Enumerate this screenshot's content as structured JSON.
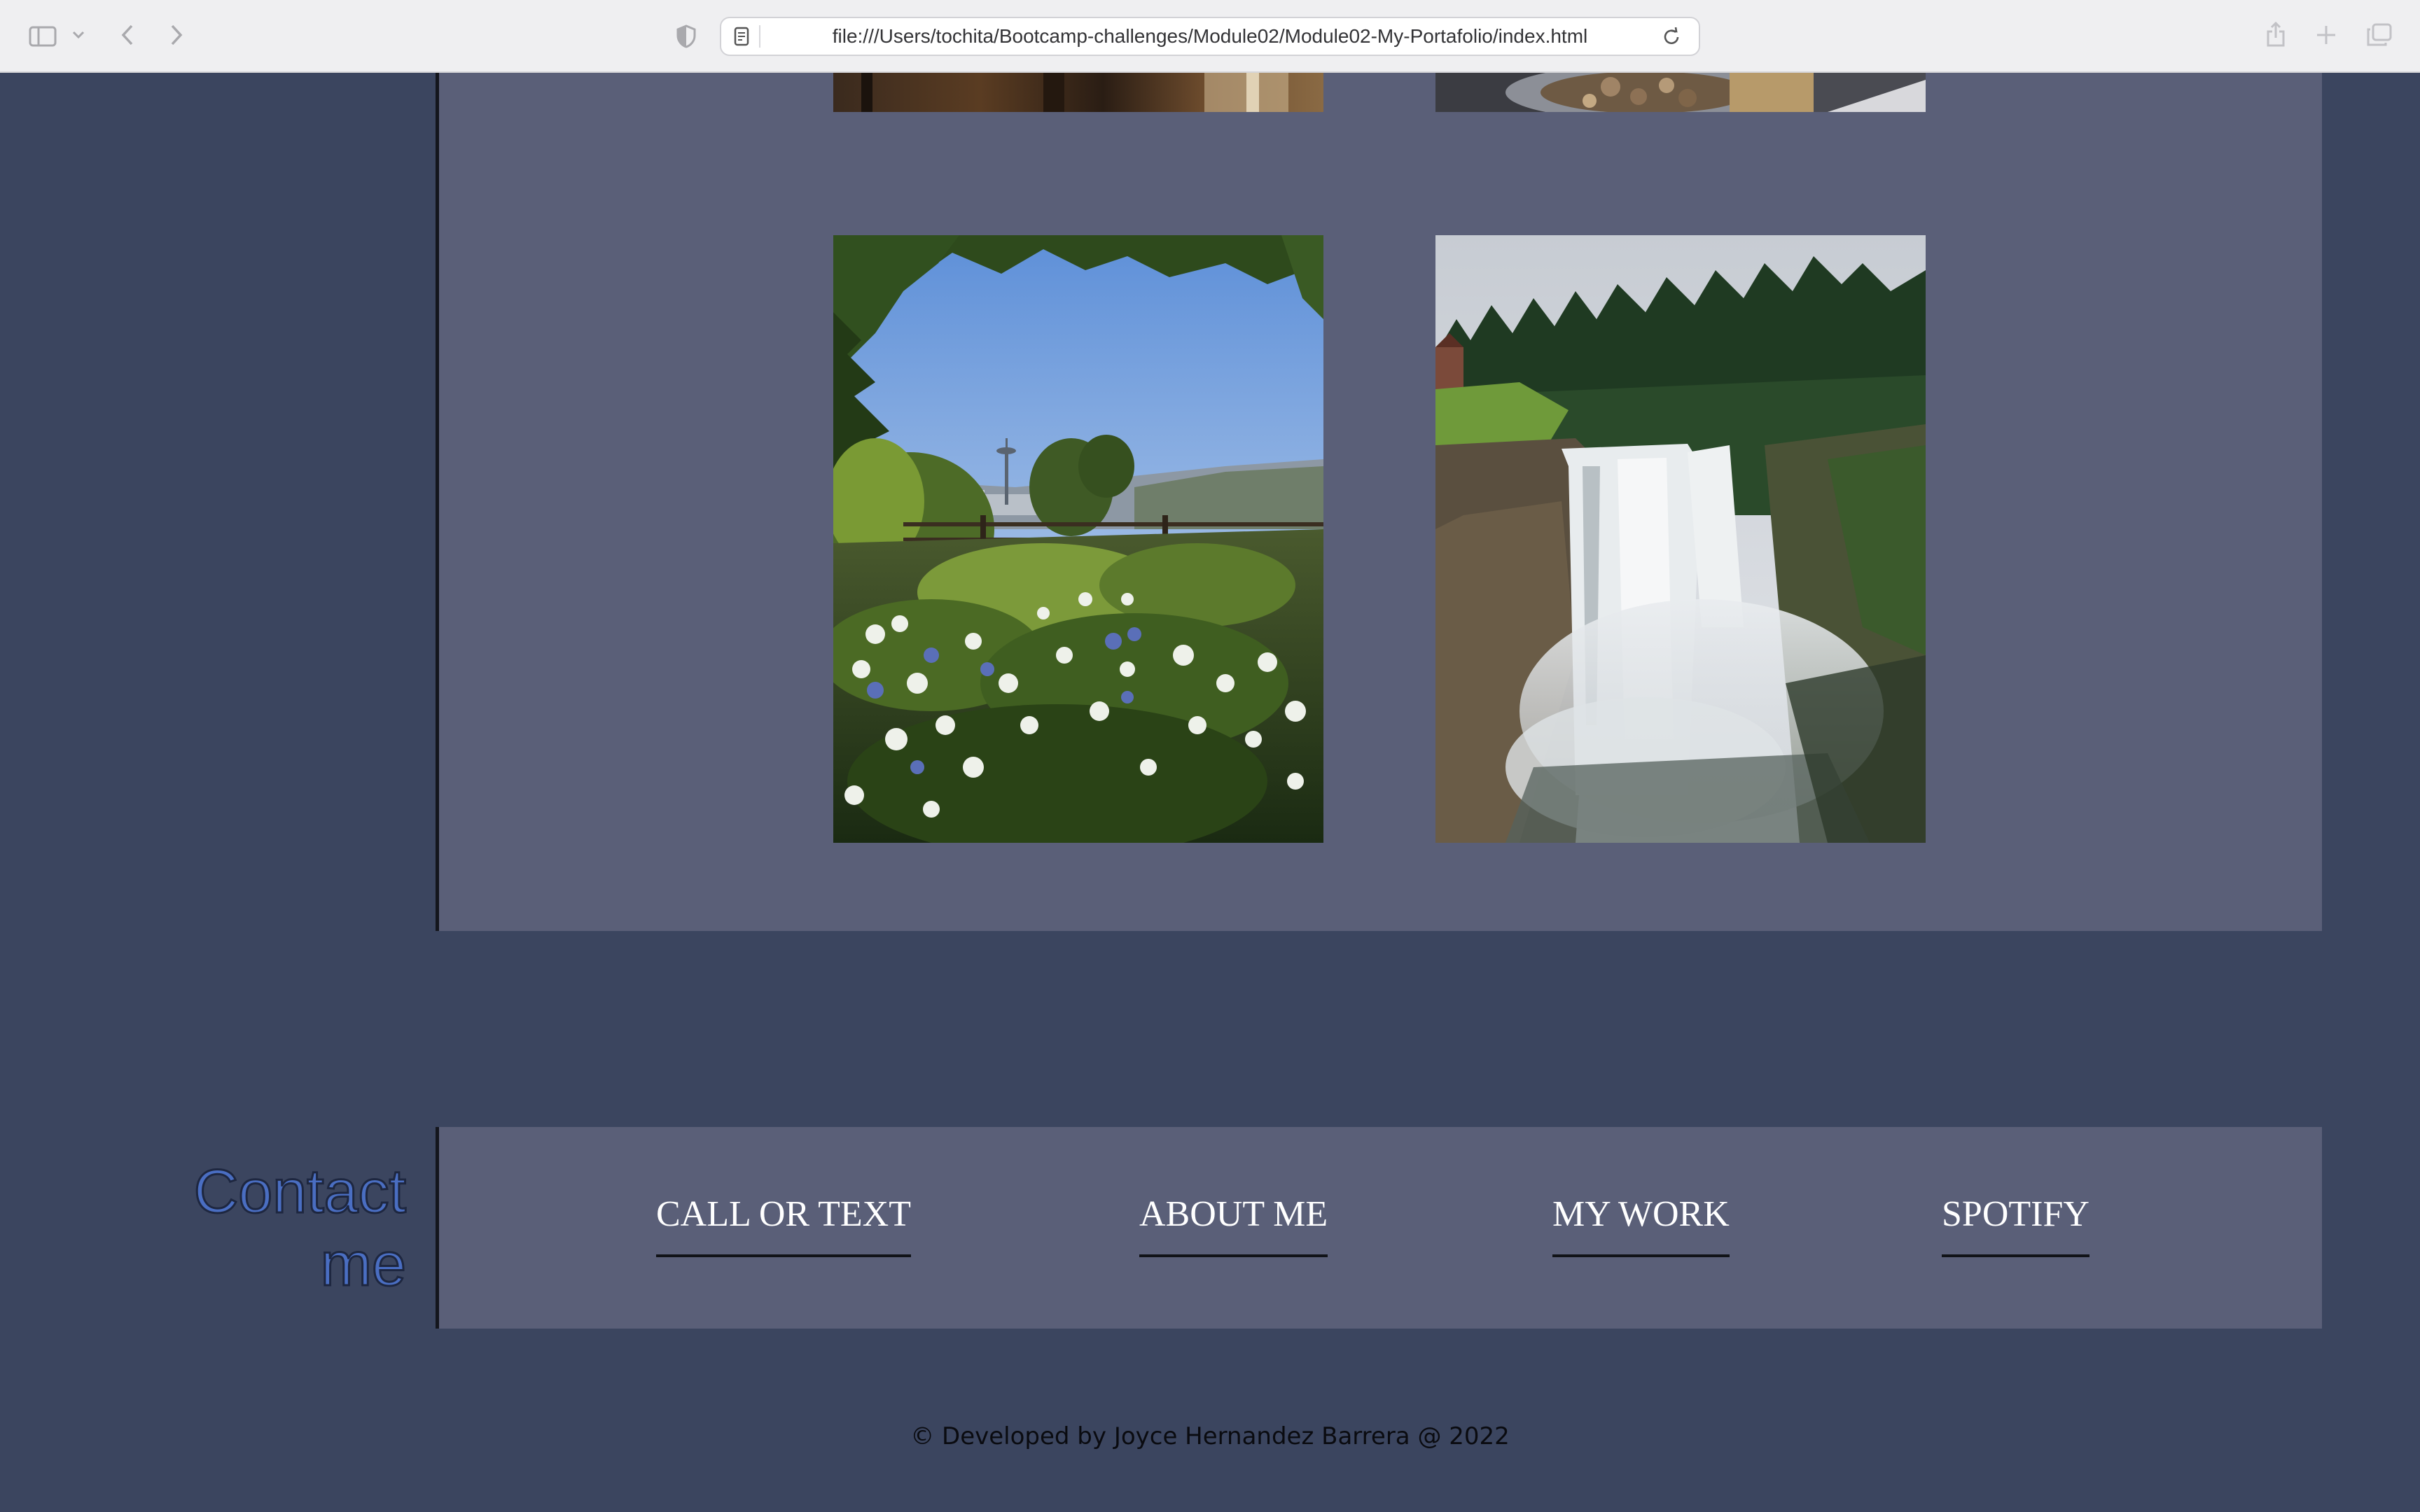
{
  "browser": {
    "url": "file:///Users/tochita/Bootcamp-challenges/Module02/Module02-My-Portafolio/index.html",
    "icons": [
      "sidebar-icon",
      "chevron-down-icon",
      "back-arrow-icon",
      "forward-arrow-icon",
      "privacy-shield-icon",
      "page-icon",
      "reload-icon",
      "share-icon",
      "new-tab-icon",
      "tab-overview-icon"
    ]
  },
  "gallery": {
    "photos": [
      {
        "subject": "top-left-cropped-photo"
      },
      {
        "subject": "top-right-cropped-photo"
      },
      {
        "subject": "seattle-skyline-with-hydrangeas"
      },
      {
        "subject": "snoqualmie-falls-waterfall"
      }
    ]
  },
  "contact": {
    "heading": "Contact me",
    "heading_color": "#4a6ec2",
    "links": [
      {
        "label": "CALL OR TEXT"
      },
      {
        "label": "ABOUT ME"
      },
      {
        "label": "MY WORK"
      },
      {
        "label": "SPOTIFY"
      }
    ]
  },
  "footer": {
    "text": "© Developed by Joyce Hernandez Barrera @ 2022"
  },
  "colors": {
    "page_background": "#3b455f",
    "panel_background": "#5a5f78"
  }
}
